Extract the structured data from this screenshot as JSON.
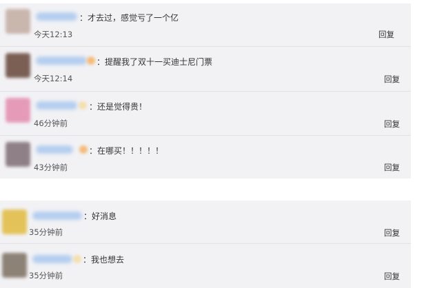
{
  "colors": {
    "panel_bg": "#f2f2f5",
    "divider": "#e1e1e6",
    "text": "#333333",
    "muted": "#555555"
  },
  "comments": [
    {
      "text": "：才去过，感觉亏了一个亿",
      "time": "今天12:13",
      "reply_label": "回复",
      "avatar_color": "#c9b6ad"
    },
    {
      "text": "：提醒我了双十一买迪士尼门票",
      "time": "今天12:14",
      "reply_label": "回复",
      "avatar_color": "#7b5f55"
    },
    {
      "text": "：还是觉得贵！",
      "time": "46分钟前",
      "reply_label": "回复",
      "avatar_color": "#e59ab8"
    },
    {
      "text": "：在哪买！！！！！",
      "time": "43分钟前",
      "reply_label": "回复",
      "avatar_color": "#8f7f86"
    },
    {
      "text": "：好消息",
      "time": "35分钟前",
      "reply_label": "回复",
      "avatar_color": "#e4c25a"
    },
    {
      "text": "：我也想去",
      "time": "35分钟前",
      "reply_label": "回复",
      "avatar_color": "#8d8276"
    }
  ]
}
